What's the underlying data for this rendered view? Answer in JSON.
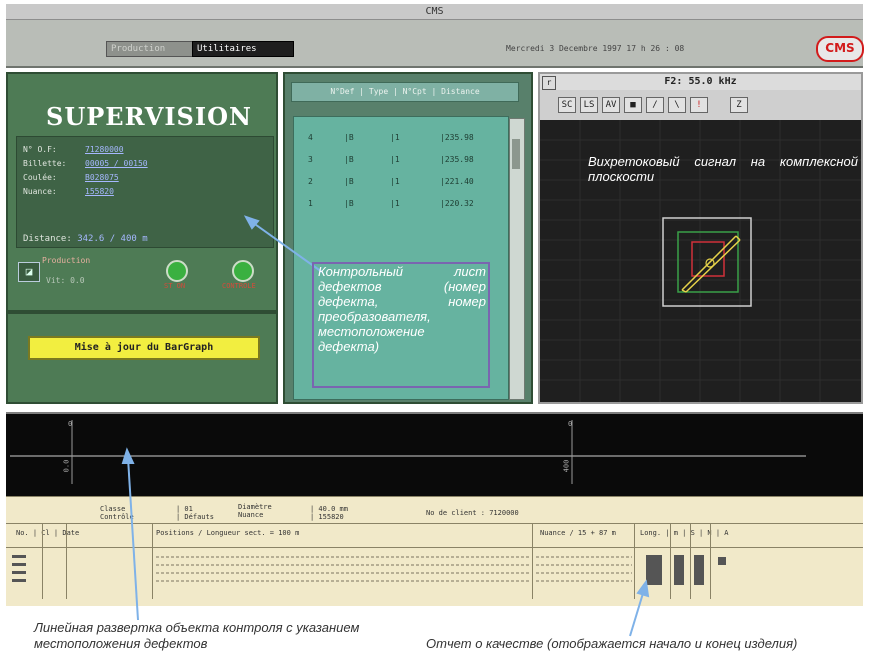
{
  "window": {
    "title": "CMS"
  },
  "menubar": {
    "tab_production": "Production",
    "tab_utilitaires": "Utilitaires",
    "datetime": "Mercredi 3 Decembre 1997  17 h 26 : 08",
    "logo": "CMS"
  },
  "supervision": {
    "title": "SUPERVISION",
    "rows": [
      {
        "label": "N° O.F:",
        "value": "71280000"
      },
      {
        "label": "Billette:",
        "value": "00005 / 00150"
      },
      {
        "label": "Coulée:",
        "value": "B028075"
      },
      {
        "label": "Nuance:",
        "value": "155820"
      }
    ],
    "distance_label": "Distance:",
    "distance_value": "342.6 / 400 m",
    "production_label": "Production",
    "production_sub": "Vit: 0.0",
    "led1_label": "ST ON",
    "led2_label": "CONTROLE"
  },
  "bargraph": {
    "button_label": "Mise à jour du BarGraph"
  },
  "defects": {
    "header": "N°Def | Type | N°Cpt | Distance",
    "rows": [
      {
        "num": "4",
        "type": "|B",
        "cpt": "|1",
        "dist": "|235.98"
      },
      {
        "num": "3",
        "type": "|B",
        "cpt": "|1",
        "dist": "|235.98"
      },
      {
        "num": "2",
        "type": "|B",
        "cpt": "|1",
        "dist": "|221.40"
      },
      {
        "num": "1",
        "type": "|B",
        "cpt": "|1",
        "dist": "|220.32"
      }
    ]
  },
  "signal": {
    "header": "F2: 55.0 kHz",
    "corner": "r",
    "tools": [
      "SC",
      "LS",
      "AV",
      "■",
      "/",
      "\\",
      "!",
      "Z"
    ]
  },
  "scan": {
    "marker_left": "0",
    "marker_right": "0",
    "label_left": "0.0",
    "label_right": "400"
  },
  "report": {
    "row1": [
      "Classe",
      "Contrôle",
      "| 01",
      "| Défauts",
      "Diamètre",
      "Nuance",
      "| 40.0 mm",
      "| 155820",
      "No de client : 7120000"
    ],
    "row2_left": "No. | Cl | Date",
    "row2_mid": "Positions / Longueur sect. = 100 m",
    "row2_right": "Nuance / 15 + 87 m",
    "row2_far": "Long. | m | S | N | A"
  },
  "annotations": {
    "defects_note": "Контрольный лист дефектов (номер дефекта, номер преобразователя, местоположение дефекта)",
    "signal_note": "Вихретоковый сигнал на комплексной плоскости",
    "linear_caption": "Линейная развертка объекта контроля с указанием местоположения дефектов",
    "report_caption": "Отчет о качестве (отображается начало и конец изделия)"
  },
  "colors": {
    "panel_green": "#4e7b55",
    "table_teal": "#66b3a0",
    "button_yellow": "#f2ee40",
    "logo_red": "#d21b1b",
    "report_beige": "#f1e9c9",
    "arrow_blue": "#7fb2e8"
  }
}
